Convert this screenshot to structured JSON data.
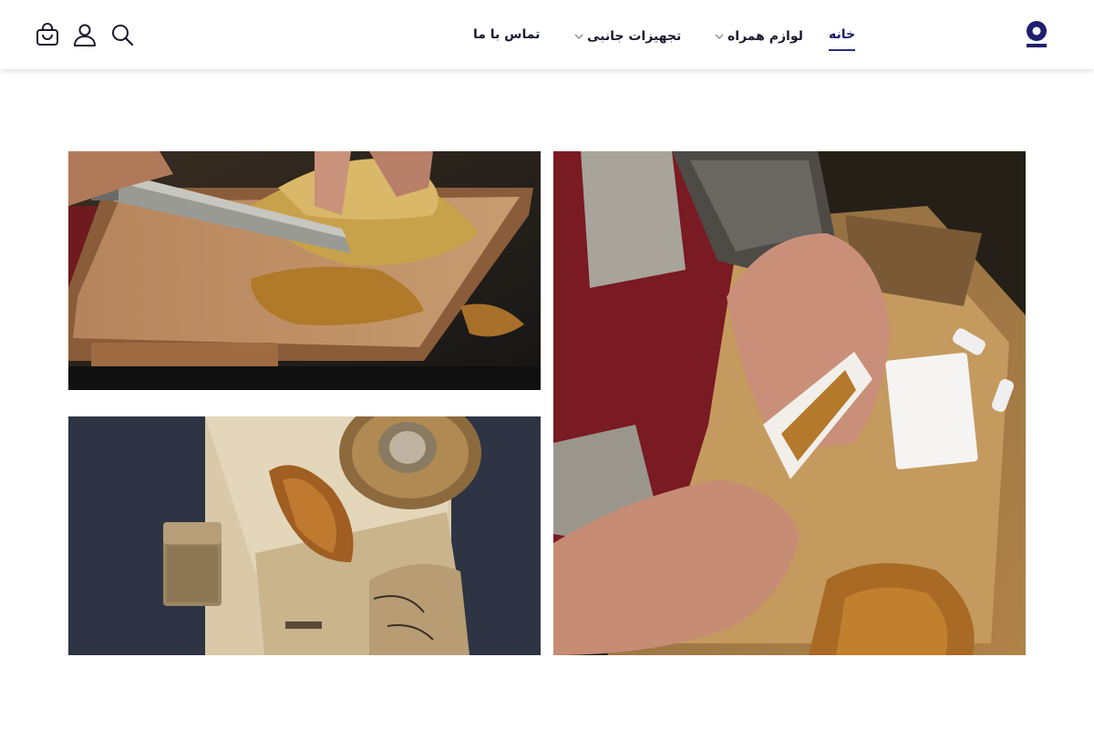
{
  "nav": {
    "items": [
      {
        "label": "خانه",
        "active": true,
        "dropdown": false
      },
      {
        "label": "لوازم همراه",
        "active": false,
        "dropdown": true
      },
      {
        "label": "تجهیزات جانبی",
        "active": false,
        "dropdown": true
      },
      {
        "label": "تماس با ما",
        "active": false,
        "dropdown": false
      }
    ]
  },
  "header_icons": [
    "search-icon",
    "user-icon",
    "shopping-bag-icon"
  ],
  "colors": {
    "brand": "#1f1f6e",
    "nav_text": "#1a1a2e",
    "background": "#ffffff"
  },
  "gallery": {
    "images": [
      {
        "name": "knife-cutting-tobacco-photo"
      },
      {
        "name": "rolling-papers-lighter-photo"
      },
      {
        "name": "hands-rolling-cigarette-photo"
      }
    ]
  }
}
